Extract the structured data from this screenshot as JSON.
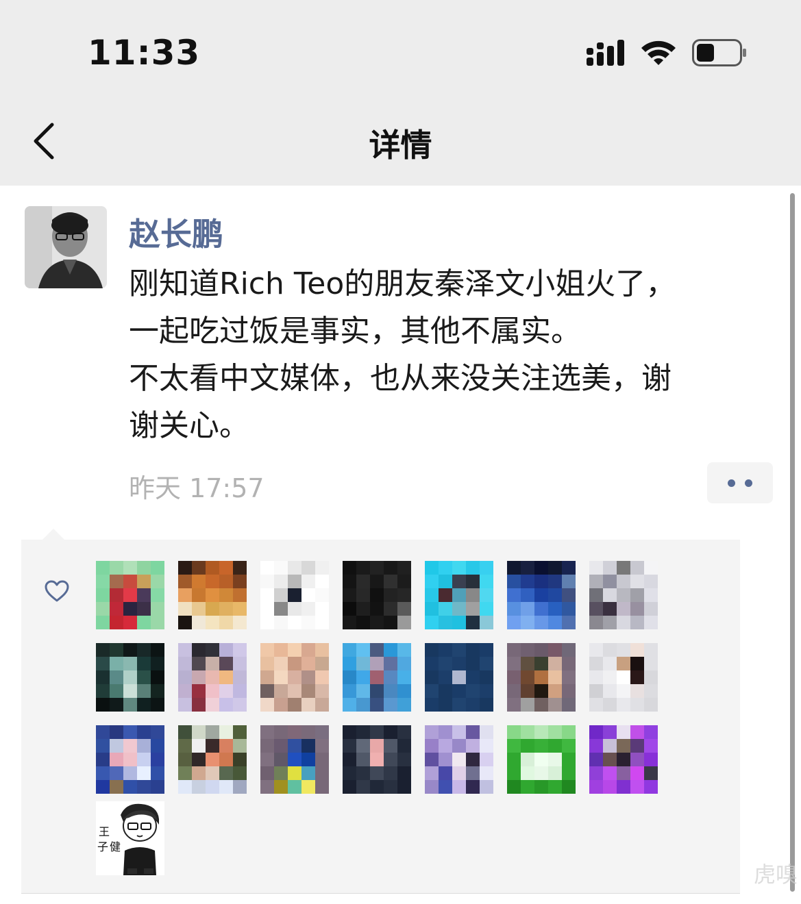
{
  "status_bar": {
    "time": "11:33"
  },
  "nav": {
    "title": "详情"
  },
  "post": {
    "author": "赵长鹏",
    "lines": [
      "刚知道Rich Teo的朋友秦泽文小姐火了，",
      "一起吃过饭是事实，其他不属实。",
      "不太看中文媒体，也从来没关注选美，谢",
      "谢关心。"
    ],
    "timestamp": "昨天 17:57"
  },
  "likes": {
    "icon": "heart-icon",
    "avatars": [
      [
        "#7ed6a0",
        "#9ad8a8",
        "#b0e0b8",
        "#8fd4a0",
        "#7ed6a0",
        "#86d9a6",
        "#a56b4e",
        "#c84b3e",
        "#c8a05a",
        "#9ad8a8",
        "#7ed6a0",
        "#b32b35",
        "#e23a48",
        "#4a3a5a",
        "#86d9a6",
        "#9ad8a8",
        "#c02838",
        "#2a2440",
        "#3c3048",
        "#9ad8a8",
        "#7ed6a0",
        "#c42530",
        "#d62a3a",
        "#7ed6a0",
        "#9ad8a8"
      ],
      [
        "#2a1a14",
        "#6a3a1e",
        "#b05a22",
        "#c8652a",
        "#3a2418",
        "#a05a2a",
        "#d07a30",
        "#c8682a",
        "#b86028",
        "#7a4020",
        "#e8a060",
        "#c87830",
        "#e09040",
        "#d08838",
        "#c07030",
        "#f0e0c0",
        "#e8c890",
        "#d8a850",
        "#e0b060",
        "#e8b868",
        "#1a1410",
        "#f0e8d8",
        "#f4e4c0",
        "#f0d8a8",
        "#f4e8d0"
      ],
      [
        "#ffffff",
        "#fafafa",
        "#e8e8e8",
        "#d8d8d8",
        "#f0f0f0",
        "#f8f8f8",
        "#ececec",
        "#b8b8b8",
        "#f0f0f0",
        "#ffffff",
        "#ffffff",
        "#d0d0d0",
        "#1a2030",
        "#ffffff",
        "#fafafa",
        "#ffffff",
        "#888888",
        "#e8e8e8",
        "#f0f0f0",
        "#ffffff",
        "#ffffff",
        "#f8f8f8",
        "#ffffff",
        "#fafafa",
        "#ffffff"
      ],
      [
        "#101010",
        "#1a1a1a",
        "#222222",
        "#181818",
        "#202020",
        "#141414",
        "#2a2a2a",
        "#181818",
        "#303030",
        "#1c1c1c",
        "#1a1a1a",
        "#282828",
        "#101010",
        "#222222",
        "#262626",
        "#0c0c0c",
        "#1e1e1e",
        "#121212",
        "#2c2c2c",
        "#5a5a5a",
        "#181818",
        "#101010",
        "#1a1a1a",
        "#141414",
        "#9a9a9a"
      ],
      [
        "#20c8e8",
        "#30d0f0",
        "#40d8f0",
        "#28c8e8",
        "#38d0f0",
        "#30d0f0",
        "#20c0e0",
        "#3a4050",
        "#28303a",
        "#40d8f0",
        "#28c8e8",
        "#4a2a30",
        "#50a0b8",
        "#888888",
        "#50d8f0",
        "#20c0e0",
        "#40d0e8",
        "#70b8c8",
        "#a0a0a0",
        "#40d8f0",
        "#30d0f0",
        "#28c0e0",
        "#20c0e0",
        "#203040",
        "#8ac8d8"
      ],
      [
        "#101830",
        "#182040",
        "#0a1030",
        "#101830",
        "#182450",
        "#2850a0",
        "#203c90",
        "#1a3080",
        "#203880",
        "#6080b0",
        "#4070d0",
        "#3060c0",
        "#1a40a0",
        "#2048a0",
        "#405080",
        "#5890e0",
        "#70a0e8",
        "#4070d0",
        "#2860c0",
        "#3058a0",
        "#70a0f0",
        "#80b0f0",
        "#6898e8",
        "#5088e0",
        "#5070b0"
      ],
      [
        "#e8e8ec",
        "#d0d0d8",
        "#787878",
        "#c8c8d0",
        "#f4f4f6",
        "#b0b0b8",
        "#9090a0",
        "#c8c8d0",
        "#e0e0e6",
        "#d8d8e0",
        "#707078",
        "#d8d8e0",
        "#b8b8c0",
        "#a0a0a8",
        "#e0e0e8",
        "#585060",
        "#3a3040",
        "#c0b8c8",
        "#9890a0",
        "#d0d0d8",
        "#8a8890",
        "#a0a0a8",
        "#d8d8e0",
        "#b8b8c4",
        "#e0e0e8"
      ],
      [
        "#1a2a28",
        "#203830",
        "#101818",
        "#182828",
        "#0c1414",
        "#2a4a48",
        "#7ab0a8",
        "#8ab8b0",
        "#1a3a38",
        "#102020",
        "#1a3030",
        "#5a8a88",
        "#b0d0c8",
        "#2a5048",
        "#0a1010",
        "#203c38",
        "#4a7a70",
        "#cce0d8",
        "#5a8078",
        "#142420",
        "#0a1010",
        "#101a1a",
        "#608880",
        "#102020",
        "#0c1414"
      ],
      [
        "#c8c0e0",
        "#2a2830",
        "#303038",
        "#b8b0d8",
        "#d0c8e8",
        "#c0b8d8",
        "#504850",
        "#c8b0a8",
        "#5a4858",
        "#c8c0e0",
        "#b8b0d0",
        "#c8a8b0",
        "#e8b8b0",
        "#f0b880",
        "#c0b8d8",
        "#c0b0d0",
        "#983040",
        "#f0c0c8",
        "#e0d0e8",
        "#c0b8e0",
        "#c8c0e0",
        "#883040",
        "#f0d0d8",
        "#c8c0e8",
        "#d0c8e8"
      ],
      [
        "#f0c8a8",
        "#e8b898",
        "#f4d0b0",
        "#d8a890",
        "#e8c0a0",
        "#e8c0a0",
        "#f0d0b8",
        "#c89880",
        "#e0b098",
        "#c8a890",
        "#d0a890",
        "#f4d8c0",
        "#d8b0a0",
        "#b09088",
        "#f0c8b0",
        "#706060",
        "#c8a898",
        "#e0c0b0",
        "#a88878",
        "#d8b8a8",
        "#f0d8c8",
        "#c8a090",
        "#a08070",
        "#e8d0c0",
        "#c8a898"
      ],
      [
        "#40a8e0",
        "#60c0f0",
        "#4a5a80",
        "#2a98d8",
        "#58b8e8",
        "#30a0e0",
        "#70b8d8",
        "#b0a0b8",
        "#6070a0",
        "#50a8e0",
        "#2888c8",
        "#40a8e8",
        "#a06070",
        "#5888c0",
        "#48b0e8",
        "#3898d8",
        "#60b8e8",
        "#304870",
        "#4a88c0",
        "#3090d0",
        "#50b0e8",
        "#4898d0",
        "#385080",
        "#5a98d0",
        "#40a0d8"
      ],
      [
        "#183860",
        "#1a3c68",
        "#204470",
        "#183860",
        "#1a3c68",
        "#1a3c68",
        "#204470",
        "#1c3e6a",
        "#183860",
        "#204470",
        "#183860",
        "#1c3e6a",
        "#b0b8d0",
        "#1a3c68",
        "#183860",
        "#204470",
        "#183860",
        "#1a3c68",
        "#204470",
        "#1c3e6a",
        "#1a3c68",
        "#183860",
        "#204470",
        "#1c3e6a",
        "#183860"
      ],
      [
        "#786878",
        "#706070",
        "#6a5a6a",
        "#785868",
        "#706878",
        "#807080",
        "#605040",
        "#3a4030",
        "#d0b0a0",
        "#786878",
        "#786070",
        "#704830",
        "#b07040",
        "#e8c0a0",
        "#807080",
        "#786878",
        "#604030",
        "#201810",
        "#d0a080",
        "#786878",
        "#807080",
        "#a0a0a0",
        "#706060",
        "#a09090",
        "#706878"
      ],
      [
        "#e8e8ec",
        "#dcdce0",
        "#e0e0e4",
        "#f0e0d8",
        "#e0e0e4",
        "#d8d8dc",
        "#e8e8ec",
        "#c8a080",
        "#1a1010",
        "#e0e0e4",
        "#e8e8ec",
        "#f0f0f2",
        "#ffffff",
        "#2a1818",
        "#d8d8dc",
        "#d0d0d4",
        "#e8e8ec",
        "#f4f4f6",
        "#e8e0e0",
        "#dcdce0",
        "#e0e0e4",
        "#d8d8dc",
        "#e8e8ec",
        "#e0e0e4",
        "#d8d8dc"
      ],
      [
        "#304898",
        "#283880",
        "#3a58b0",
        "#2a4090",
        "#304898",
        "#3050a0",
        "#c0c8e0",
        "#f0c8d0",
        "#a8b0d8",
        "#2848a0",
        "#283c88",
        "#e8a8b8",
        "#f0c0c8",
        "#c8d0f0",
        "#2a40a0",
        "#3858b0",
        "#5068b8",
        "#b0b8e0",
        "#e8f0ff",
        "#3050a8",
        "#2038a0",
        "#887050",
        "#3050a8",
        "#304898",
        "#2a4090"
      ],
      [
        "#40503a",
        "#d0d8c8",
        "#a0a8a0",
        "#e8f0e0",
        "#50603a",
        "#606a48",
        "#f0f0f0",
        "#3a2a2a",
        "#d88060",
        "#a8b898",
        "#586040",
        "#302828",
        "#e89070",
        "#d07850",
        "#3a4028",
        "#708058",
        "#d0a890",
        "#e0c8b8",
        "#586850",
        "#485838",
        "#e0e8f8",
        "#c8d0e0",
        "#d0d8f0",
        "#e0e8f8",
        "#a0a8c0"
      ],
      [
        "#807080",
        "#786878",
        "#806878",
        "#7a6a7a",
        "#7a6e80",
        "#786878",
        "#6a5a70",
        "#3050a0",
        "#183060",
        "#807080",
        "#807080",
        "#605868",
        "#2050c0",
        "#1040a0",
        "#786878",
        "#706070",
        "#708058",
        "#e0e040",
        "#48a0c0",
        "#786878",
        "#807080",
        "#a09020",
        "#60c0a0",
        "#f0e860",
        "#786878"
      ],
      [
        "#1a2030",
        "#202838",
        "#303848",
        "#1a2030",
        "#283040",
        "#283040",
        "#606878",
        "#e8a8a8",
        "#505868",
        "#202838",
        "#1a2030",
        "#505868",
        "#f0b0b0",
        "#404858",
        "#283040",
        "#202838",
        "#283040",
        "#404858",
        "#303848",
        "#1a2030",
        "#1a2030",
        "#303848",
        "#202838",
        "#283040",
        "#1a2030"
      ],
      [
        "#b0a0d8",
        "#a090d0",
        "#c8c0e8",
        "#6858a0",
        "#e0e0f0",
        "#9880c8",
        "#b8a8e0",
        "#9888c8",
        "#c0b0e0",
        "#e8e8f8",
        "#6050a0",
        "#a090d0",
        "#f0e8f0",
        "#302840",
        "#d8d0f0",
        "#b0a0d8",
        "#4848a8",
        "#e0d0e8",
        "#707090",
        "#e8e8f8",
        "#9888c8",
        "#4050b0",
        "#c8b8e8",
        "#302850",
        "#c0c0e0"
      ],
      [
        "#88d888",
        "#a0e0a0",
        "#b8e8b8",
        "#a0e0a0",
        "#88d888",
        "#40b840",
        "#30a830",
        "#38b038",
        "#30a830",
        "#40b840",
        "#30a830",
        "#d8f0d8",
        "#f0fff0",
        "#e8f8e8",
        "#30a830",
        "#30a830",
        "#e0f8e0",
        "#e8f8e8",
        "#d8f0d8",
        "#30a830",
        "#208820",
        "#30a830",
        "#289828",
        "#30a830",
        "#208820"
      ],
      [
        "#7028c8",
        "#8a40d8",
        "#e8e0f0",
        "#c050e8",
        "#9040e0",
        "#8838d8",
        "#c8c0d8",
        "#7a6858",
        "#5a3a78",
        "#a048e8",
        "#6030b0",
        "#685050",
        "#2a2030",
        "#9050c0",
        "#8830d8",
        "#9040d8",
        "#c050f0",
        "#8860a0",
        "#d048f0",
        "#3a3848",
        "#a040e0",
        "#b848e8",
        "#8030d0",
        "#c050f0",
        "#9038e0"
      ]
    ],
    "last_liker_name": "王子健"
  },
  "colors": {
    "author_link": "#576b95",
    "timestamp": "#b2b2b2",
    "likes_bg": "#f4f4f4",
    "nav_bg": "#ededed"
  },
  "watermark": "虎嗅"
}
